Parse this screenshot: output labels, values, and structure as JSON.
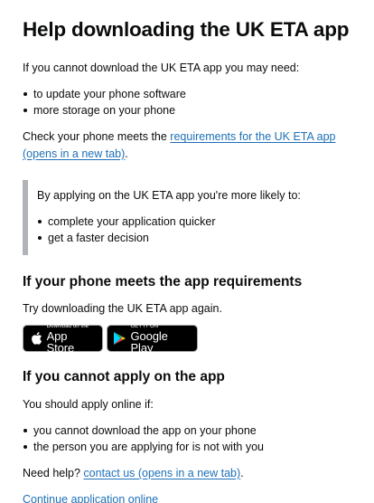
{
  "page": {
    "title": "Help downloading the UK ETA app",
    "intro": "If you cannot download the UK ETA app you may need:",
    "needs": [
      "to update your phone software",
      "more storage on your phone"
    ],
    "check_prefix": "Check your phone meets the ",
    "check_link": "requirements for the UK ETA app (opens in a new tab)",
    "check_suffix": "."
  },
  "inset": {
    "lead": "By applying on the UK ETA app you're more likely to:",
    "benefits": [
      "complete your application quicker",
      "get a faster decision"
    ]
  },
  "section_meets": {
    "heading": "If your phone meets the app requirements",
    "text": "Try downloading the UK ETA app again."
  },
  "badges": {
    "appstore_small": "Download on the",
    "appstore_big": "App Store",
    "google_small": "GET IT ON",
    "google_big": "Google Play"
  },
  "section_cannot": {
    "heading": "If you cannot apply on the app",
    "text": "You should apply online if:",
    "reasons": [
      "you cannot download the app on your phone",
      "the person you are applying for is not with you"
    ],
    "help_prefix": "Need help? ",
    "help_link": "contact us (opens in a new tab)",
    "help_suffix": ".",
    "continue_link": "Continue application online"
  },
  "colors": {
    "link": "#1d70b8",
    "text": "#0b0c0c",
    "inset_border": "#b1b4b6"
  }
}
